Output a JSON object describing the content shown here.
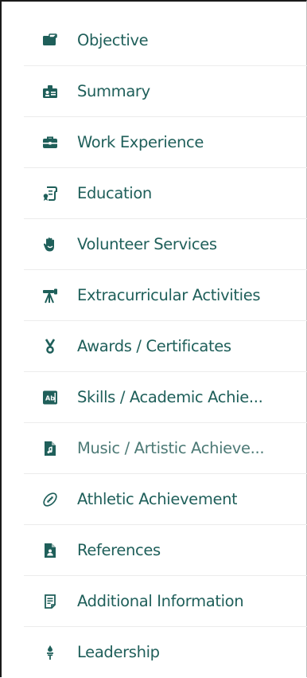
{
  "theme": {
    "text_color": "#1f5f5a",
    "icon_color": "#1f5f5a",
    "divider_color": "#ececec"
  },
  "menu": {
    "items": [
      {
        "label": "Objective",
        "icon": "id-card-icon"
      },
      {
        "label": "Summary",
        "icon": "contact-badge-icon"
      },
      {
        "label": "Work Experience",
        "icon": "briefcase-icon"
      },
      {
        "label": "Education",
        "icon": "diploma-icon"
      },
      {
        "label": "Volunteer Services",
        "icon": "raised-hand-icon"
      },
      {
        "label": "Extracurricular Activities",
        "icon": "telescope-icon"
      },
      {
        "label": "Awards / Certificates",
        "icon": "medal-icon"
      },
      {
        "label": "Skills / Academic Achie...",
        "icon": "ab-badge-icon"
      },
      {
        "label": "Music / Artistic Achieve...",
        "icon": "music-file-icon"
      },
      {
        "label": "Athletic Achievement",
        "icon": "football-icon"
      },
      {
        "label": "References",
        "icon": "person-file-icon"
      },
      {
        "label": "Additional Information",
        "icon": "note-pad-icon"
      },
      {
        "label": "Leadership",
        "icon": "leader-pin-icon"
      }
    ]
  }
}
